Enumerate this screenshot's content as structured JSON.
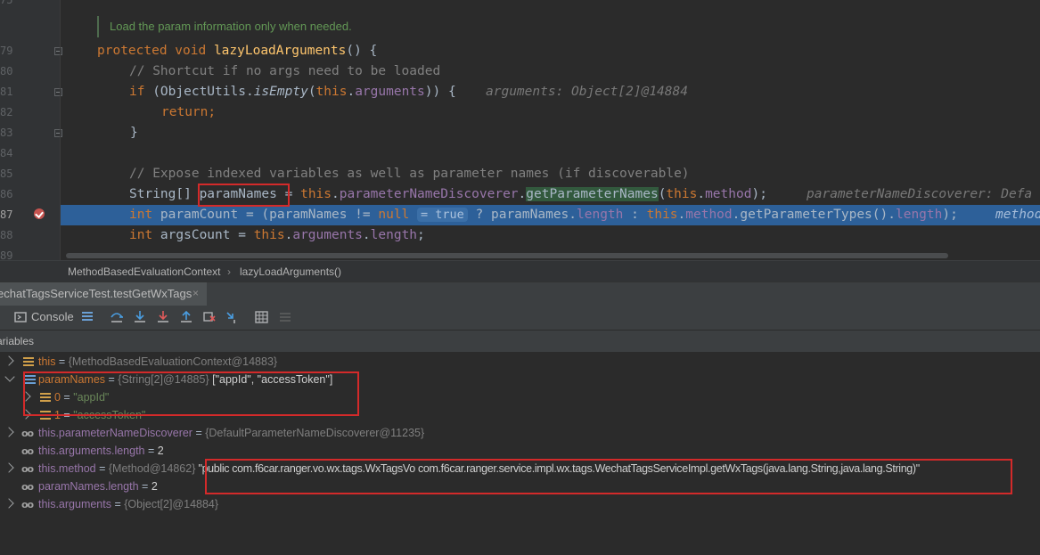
{
  "editor": {
    "line_numbers": [
      "75",
      "79",
      "80",
      "81",
      "82",
      "83",
      "84",
      "85",
      "86",
      "87",
      "88",
      "89"
    ],
    "doc_comment": "Load the param information only when needed.",
    "l79": {
      "kw": "protected void ",
      "fn": "lazyLoadArguments",
      "rest": "() {"
    },
    "l80": {
      "comment": "// Shortcut if no args need to be loaded"
    },
    "l81": {
      "kw": "if ",
      "p1": "(ObjectUtils.",
      "m": "isEmpty",
      "p2": "(",
      "this": "this",
      "dot": ".",
      "fld": "arguments",
      "end": ")) {",
      "hint": "arguments: Object[2]@14884"
    },
    "l82": {
      "kw": "return;"
    },
    "l83": {
      "text": "}"
    },
    "l85": {
      "comment": "// Expose indexed variables as well as parameter names (if discoverable)"
    },
    "l86": {
      "p1": "String[] ",
      "var": "paramNames",
      "p2": " = ",
      "this": "this",
      "dot": ".",
      "fld": "parameterNameDiscoverer",
      "dot2": ".",
      "m": "getParameterNames",
      "p3": "(",
      "this2": "this",
      "dot3": ".",
      "fld2": "method",
      "end": ");",
      "hint": "parameterNameDiscoverer: Defa"
    },
    "l87": {
      "kw": "int ",
      "p1": "paramCount = (paramNames != ",
      "null": "null",
      "inlay": "= true",
      "p2": " ? paramNames.",
      "fld": "length",
      "p3": " : ",
      "this": "this",
      "dot": ".",
      "fld2": "method",
      "p4": ".getParameterTypes().",
      "fld3": "length",
      "end": ");",
      "hint": "method"
    },
    "l88": {
      "kw": "int ",
      "p1": "argsCount = ",
      "this": "this",
      "dot": ".",
      "fld": "arguments",
      "p2": ".",
      "fld2": "length",
      "end": ";"
    }
  },
  "breadcrumb": {
    "class": "MethodBasedEvaluationContext",
    "sep": "›",
    "method": "lazyLoadArguments()"
  },
  "debug_tab": {
    "label": "echatTagsServiceTest.testGetWxTags",
    "close": "×"
  },
  "toolbar": {
    "console_label": "Console"
  },
  "variables": {
    "header": "ariables",
    "rows": [
      {
        "name": "this",
        "eq": " = ",
        "type": "{MethodBasedEvaluationContext@14883}",
        "value": ""
      },
      {
        "name": "paramNames",
        "eq": " = ",
        "type": "{String[2]@14885}",
        "value": " [\"appId\", \"accessToken\"]"
      },
      {
        "name": "0",
        "eq": " = ",
        "type": "",
        "value": "\"appId\""
      },
      {
        "name": "1",
        "eq": " = ",
        "type": "",
        "value": "\"accessToken\""
      },
      {
        "name": "this.parameterNameDiscoverer",
        "eq": " = ",
        "type": "{DefaultParameterNameDiscoverer@11235}",
        "value": ""
      },
      {
        "name": "this.arguments.length",
        "eq": " = ",
        "type": "",
        "value": "2"
      },
      {
        "name": "this.method",
        "eq": " = ",
        "type": "{Method@14862}",
        "value": " \"public com.f6car.ranger.vo.wx.tags.WxTagsVo com.f6car.ranger.service.impl.wx.tags.WechatTagsServiceImpl.getWxTags(java.lang.String,java.lang.String)\""
      },
      {
        "name": "paramNames.length",
        "eq": " = ",
        "type": "",
        "value": "2"
      },
      {
        "name": "this.arguments",
        "eq": " = ",
        "type": "{Object[2]@14884}",
        "value": ""
      }
    ]
  },
  "colors": {
    "keyword": "#cc7832",
    "function": "#ffc66d",
    "field": "#9876aa",
    "exec_line": "#2d6099",
    "highlight_box": "#d32a2a"
  },
  "icons": [
    "fold-icon",
    "breakpoint-check-icon",
    "console-icon",
    "list-icon",
    "step-over-icon",
    "step-into-icon",
    "force-step-into-icon",
    "step-out-icon",
    "drop-frame-icon",
    "run-to-cursor-icon",
    "evaluate-icon",
    "trace-icon",
    "field-icon",
    "array-icon",
    "watch-icon"
  ]
}
